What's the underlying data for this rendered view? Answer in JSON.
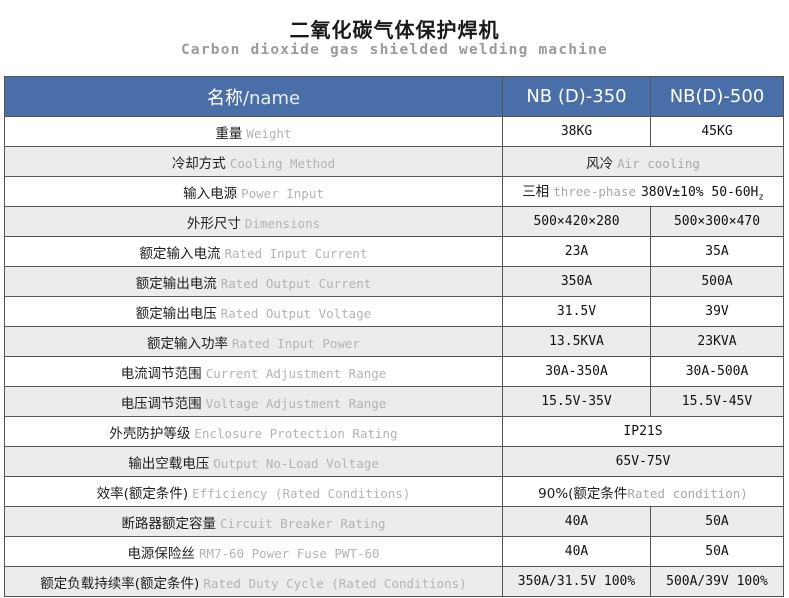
{
  "title": "二氧化碳气体保护焊机",
  "subtitle": "Carbon dioxide gas shielded welding machine",
  "header": {
    "name_zh": "名称",
    "name_en": "/name",
    "model1": "NB (D)-350",
    "model2": "NB(D)-500"
  },
  "rows": [
    {
      "zh": "重量",
      "en": "Weight",
      "v1": "38KG",
      "v2": "45KG"
    },
    {
      "zh": "冷却方式",
      "en": "Cooling Method",
      "merged": true,
      "v_zh": "风冷",
      "v_en": "Air cooling"
    },
    {
      "zh": "输入电源",
      "en": "Power Input",
      "merged": true,
      "v_zh": "三相",
      "v_en": "three-phase",
      "v_tail": "380V±10% 50-60H",
      "v_sub": "z"
    },
    {
      "zh": "外形尺寸",
      "en": "Dimensions",
      "v1": "500×420×280",
      "v2": "500×300×470"
    },
    {
      "zh": "额定输入电流",
      "en": "Rated Input Current",
      "v1": "23A",
      "v2": "35A"
    },
    {
      "zh": "额定输出电流",
      "en": "Rated Output Current",
      "v1": "350A",
      "v2": "500A"
    },
    {
      "zh": "额定输出电压",
      "en": "Rated Output Voltage",
      "v1": "31.5V",
      "v2": "39V"
    },
    {
      "zh": "额定输入功率",
      "en": "Rated Input Power",
      "v1": "13.5KVA",
      "v2": "23KVA"
    },
    {
      "zh": "电流调节范围",
      "en": "Current Adjustment Range",
      "v1": "30A-350A",
      "v2": "30A-500A"
    },
    {
      "zh": "电压调节范围",
      "en": "Voltage Adjustment Range",
      "v1": "15.5V-35V",
      "v2": "15.5V-45V"
    },
    {
      "zh": "外壳防护等级",
      "en": "Enclosure Protection Rating",
      "merged": true,
      "v_plain": "IP21S"
    },
    {
      "zh": "输出空载电压",
      "en": "Output No-Load Voltage",
      "merged": true,
      "v_plain": "65V-75V"
    },
    {
      "zh": "效率(额定条件)",
      "en": "Efficiency (Rated Conditions)",
      "merged": true,
      "v_lead": "90%(额定条件",
      "v_en": "Rated condition)"
    },
    {
      "zh": "断路器额定容量",
      "en": "Circuit Breaker Rating",
      "v1": "40A",
      "v2": "50A"
    },
    {
      "zh": "电源保险丝",
      "en": "RM7-60 Power Fuse PWT-60",
      "v1": "40A",
      "v2": "50A"
    },
    {
      "zh": "额定负载持续率(额定条件)",
      "en": "Rated Duty Cycle (Rated Conditions)",
      "v1": "350A/31.5V 100%",
      "v2": "500A/39V 100%"
    }
  ]
}
